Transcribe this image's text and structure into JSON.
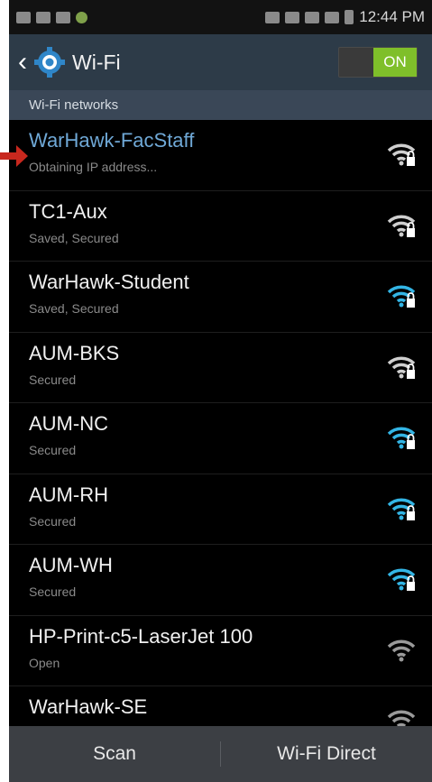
{
  "statusbar": {
    "time": "12:44 PM"
  },
  "actionbar": {
    "back_icon": "back-chevron-icon",
    "settings_icon": "gear-icon",
    "title": "Wi-Fi",
    "toggle_label": "ON"
  },
  "section": {
    "label": "Wi-Fi networks"
  },
  "networks": [
    {
      "name": "WarHawk-FacStaff",
      "status": "Obtaining IP address...",
      "icon": "wifi-secured-icon",
      "signal_color": "#cfcfcf",
      "selected": true
    },
    {
      "name": "TC1-Aux",
      "status": "Saved, Secured",
      "icon": "wifi-secured-icon",
      "signal_color": "#cfcfcf"
    },
    {
      "name": "WarHawk-Student",
      "status": "Saved, Secured",
      "icon": "wifi-secured-icon",
      "signal_color": "#33b5e5"
    },
    {
      "name": "AUM-BKS",
      "status": "Secured",
      "icon": "wifi-secured-icon",
      "signal_color": "#cfcfcf"
    },
    {
      "name": "AUM-NC",
      "status": "Secured",
      "icon": "wifi-secured-icon",
      "signal_color": "#33b5e5"
    },
    {
      "name": "AUM-RH",
      "status": "Secured",
      "icon": "wifi-secured-icon",
      "signal_color": "#33b5e5"
    },
    {
      "name": "AUM-WH",
      "status": "Secured",
      "icon": "wifi-secured-icon",
      "signal_color": "#33b5e5"
    },
    {
      "name": "HP-Print-c5-LaserJet 100",
      "status": "Open",
      "icon": "wifi-open-icon",
      "signal_color": "#9a9a9a"
    },
    {
      "name": "WarHawk-SE",
      "status": "",
      "icon": "wifi-icon",
      "signal_color": "#9a9a9a"
    }
  ],
  "bottombar": {
    "scan_label": "Scan",
    "direct_label": "Wi-Fi Direct"
  },
  "colors": {
    "accent": "#33b5e5",
    "toggle_on": "#7fbf2a",
    "selected_text": "#6fa8d6",
    "arrow": "#c8281e"
  }
}
